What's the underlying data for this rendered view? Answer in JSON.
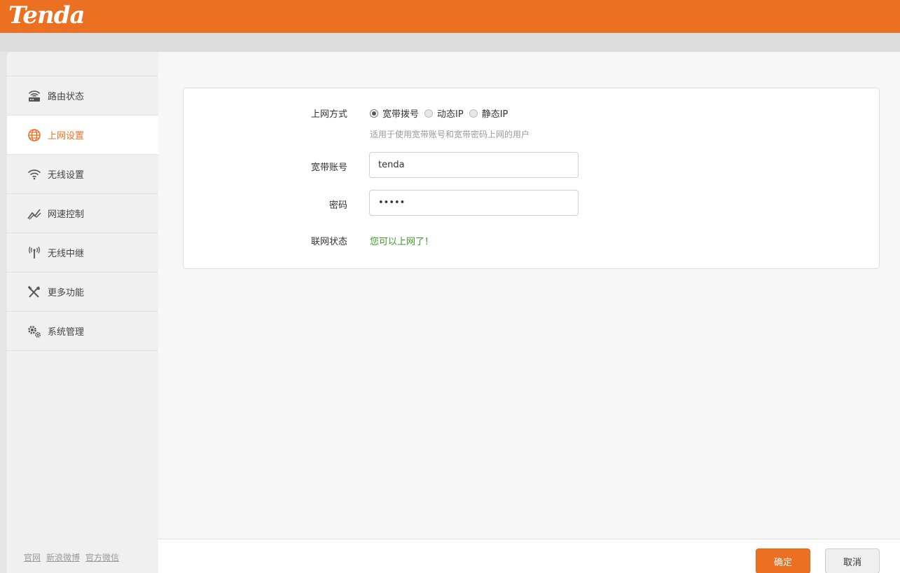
{
  "brand": {
    "logo_text": "Tenda",
    "accent": "#ec7022"
  },
  "sidebar": {
    "items": [
      {
        "label": "路由状态",
        "icon": "router-icon",
        "active": false
      },
      {
        "label": "上网设置",
        "icon": "globe-icon",
        "active": true
      },
      {
        "label": "无线设置",
        "icon": "wifi-icon",
        "active": false
      },
      {
        "label": "网速控制",
        "icon": "speed-graph-icon",
        "active": false
      },
      {
        "label": "无线中继",
        "icon": "antenna-icon",
        "active": false
      },
      {
        "label": "更多功能",
        "icon": "tools-icon",
        "active": false
      },
      {
        "label": "系统管理",
        "icon": "gears-icon",
        "active": false
      }
    ],
    "footer_links": [
      "官网",
      "新浪微博",
      "官方微信"
    ]
  },
  "form": {
    "mode_label": "上网方式",
    "modes": [
      {
        "label": "宽带拨号",
        "checked": true
      },
      {
        "label": "动态IP",
        "checked": false
      },
      {
        "label": "静态IP",
        "checked": false
      }
    ],
    "mode_hint": "适用于使用宽带账号和宽带密码上网的用户",
    "account_label": "宽带账号",
    "account_value": "tenda",
    "password_label": "密码",
    "password_value": "•••••",
    "status_label": "联网状态",
    "status_value": "您可以上网了！",
    "status_color": "#3a9d23"
  },
  "actions": {
    "ok_label": "确定",
    "cancel_label": "取消"
  }
}
